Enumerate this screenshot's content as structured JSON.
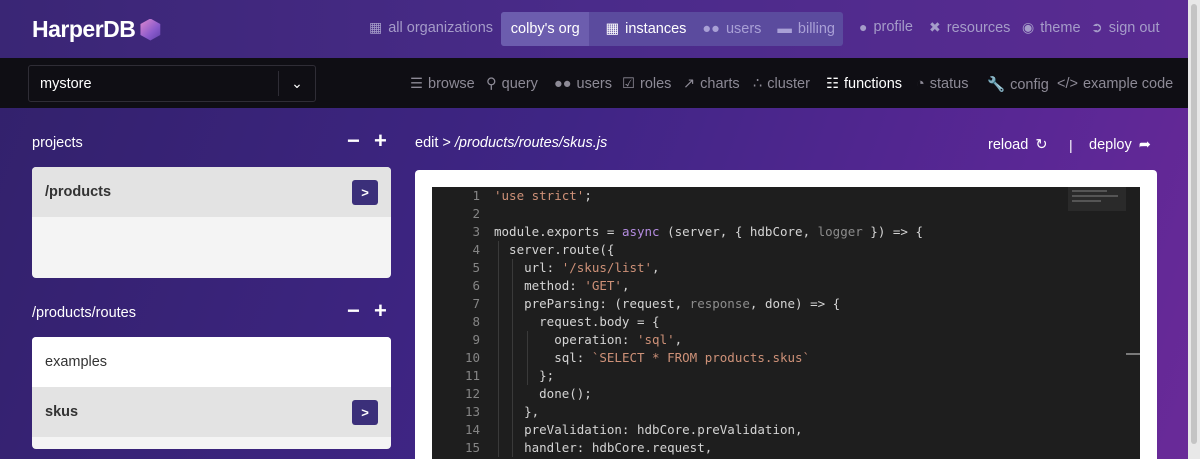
{
  "brand": {
    "name": "HarperDB"
  },
  "topnav": {
    "all_orgs": "all organizations",
    "org": "colby's org",
    "instances": "instances",
    "users": "users",
    "billing": "billing",
    "profile": "profile",
    "resources": "resources",
    "theme": "theme",
    "signout": "sign out"
  },
  "instance_select": {
    "value": "mystore"
  },
  "subnav": {
    "browse": "browse",
    "query": "query",
    "users": "users",
    "roles": "roles",
    "charts": "charts",
    "cluster": "cluster",
    "functions": "functions",
    "status": "status",
    "config": "config",
    "example_code": "example code"
  },
  "projects": {
    "title": "projects",
    "items": [
      {
        "label": "/products"
      }
    ]
  },
  "routes": {
    "title": "/products/routes",
    "items": [
      {
        "label": "examples"
      },
      {
        "label": "skus"
      }
    ]
  },
  "editor": {
    "edit_prefix": "edit >",
    "path": "/products/routes/skus.js",
    "reload": "reload",
    "separator": "|",
    "deploy": "deploy",
    "line_numbers": [
      "1",
      "2",
      "3",
      "4",
      "5",
      "6",
      "7",
      "8",
      "9",
      "10",
      "11",
      "12",
      "13",
      "14",
      "15"
    ]
  },
  "colors": {
    "accent": "#3b2f7a",
    "string": "#ce9178",
    "keyword": "#b48ce0"
  },
  "icons": {
    "org": "building-icon",
    "instances": "grid-icon",
    "users": "users-icon",
    "billing": "credit-card-icon",
    "profile": "user-icon",
    "resources": "tools-icon",
    "theme": "palette-icon",
    "signout": "sign-out-icon",
    "reload": "refresh-icon",
    "deploy": "share-arrow-icon"
  }
}
